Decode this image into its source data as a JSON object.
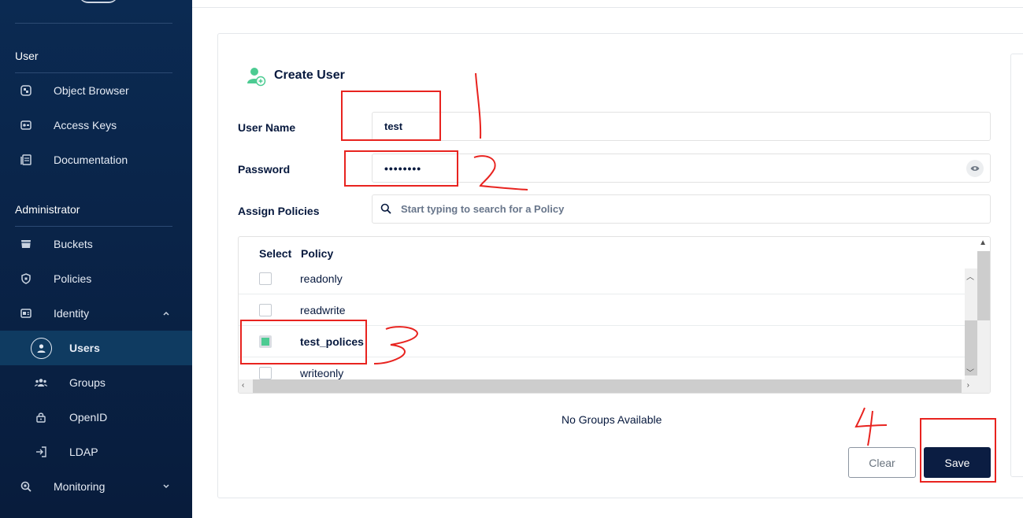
{
  "sidebar": {
    "sections": {
      "user": "User",
      "administrator": "Administrator"
    },
    "user_items": [
      {
        "label": "Object Browser",
        "icon": "object-browser-icon"
      },
      {
        "label": "Access Keys",
        "icon": "access-keys-icon"
      },
      {
        "label": "Documentation",
        "icon": "documentation-icon"
      }
    ],
    "admin_items": [
      {
        "label": "Buckets",
        "icon": "bucket-icon"
      },
      {
        "label": "Policies",
        "icon": "policy-shield-icon"
      },
      {
        "label": "Identity",
        "icon": "identity-card-icon"
      }
    ],
    "identity_sub": [
      {
        "label": "Users",
        "icon": "user-circle-icon",
        "active": true
      },
      {
        "label": "Groups",
        "icon": "groups-icon"
      },
      {
        "label": "OpenID",
        "icon": "openid-lock-icon"
      },
      {
        "label": "LDAP",
        "icon": "ldap-login-icon"
      }
    ],
    "monitoring": {
      "label": "Monitoring",
      "icon": "monitoring-icon"
    }
  },
  "form": {
    "title": "Create User",
    "username_label": "User Name",
    "username_value": "test",
    "password_label": "Password",
    "password_value": "••••••••",
    "policies_label": "Assign Policies",
    "search_placeholder": "Start typing to search for a Policy",
    "table_headers": {
      "select": "Select",
      "policy": "Policy"
    },
    "policies": [
      {
        "name": "readonly",
        "checked": false
      },
      {
        "name": "readwrite",
        "checked": false
      },
      {
        "name": "test_polices",
        "checked": true
      },
      {
        "name": "writeonly",
        "checked": false
      }
    ],
    "no_groups": "No Groups Available",
    "clear_label": "Clear",
    "save_label": "Save"
  },
  "colors": {
    "sidebar_bg": "#082146",
    "accent_green": "#4ccb92",
    "primary_button": "#0b1d42",
    "annotation_red": "#e8231f"
  }
}
